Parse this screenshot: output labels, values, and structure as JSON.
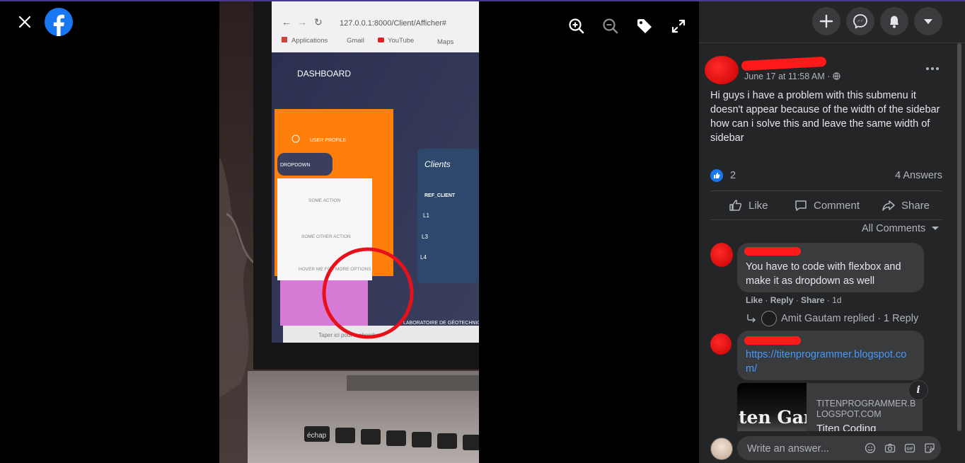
{
  "viewer": {
    "close_icon": "close-icon",
    "logo_icon": "facebook-logo-icon",
    "tools": [
      "zoom-in-icon",
      "zoom-out-icon",
      "tag-icon",
      "fullscreen-icon"
    ]
  },
  "photo": {
    "url": "127.0.0.1:8000/Client/Afficher#",
    "bookmarks": [
      "Applications",
      "Gmail",
      "YouTube",
      "Maps"
    ],
    "dashboard": "DASHBOARD",
    "user_profile": "USER PROFILE",
    "dropdown": "DROPDOWN",
    "menu_items": [
      "SOME ACTION",
      "SOME OTHER ACTION",
      "HOVER ME FOR MORE OPTIONS"
    ],
    "clients_title": "Clients",
    "table_header": "REF_CLIENT",
    "table_rows": [
      "L1",
      "L3",
      "L4"
    ],
    "footer_text": "LABORATOIRE DE GÉOTECHNIQUE",
    "taskbar_search": "Taper ici pour rechercher",
    "key_label": "échap"
  },
  "header": {
    "buttons": [
      "plus-icon",
      "messenger-icon",
      "notifications-icon",
      "caret-down-icon"
    ]
  },
  "post": {
    "date": "June 17 at 11:58 AM · ",
    "privacy_icon": "globe-icon",
    "more_icon": "more-options-icon",
    "text": "Hi guys i have a problem with this submenu it doesn't appear because of the width of the sidebar how can i solve this and leave the same width of sidebar",
    "like_count": "2",
    "answers": "4 Answers",
    "actions": {
      "like": "Like",
      "comment": "Comment",
      "share": "Share"
    },
    "all_comments": "All Comments"
  },
  "comments": [
    {
      "text": "You have to code with flexbox and make it as dropdown as well",
      "actions": {
        "like": "Like",
        "reply": "Reply",
        "share": "Share",
        "time": "1d"
      },
      "reply_summary": "Amit Gautam replied · 1 Reply"
    },
    {
      "link": "https://titenprogrammer.blogspot.com/",
      "preview": {
        "image_text": "ten Gam",
        "domain": "TITENPROGRAMMER.BLOGSPOT.COM",
        "title": "Titen Coding"
      }
    }
  ],
  "composer": {
    "placeholder": "Write an answer...",
    "icons": [
      "emoji-icon",
      "camera-icon",
      "gif-icon",
      "sticker-icon"
    ]
  },
  "colors": {
    "panel_bg": "#242526",
    "bubble_bg": "#3a3b3c",
    "text_primary": "#e4e6eb",
    "text_secondary": "#b0b3b8",
    "link": "#4599ff",
    "redaction": "#ff1a1a"
  }
}
